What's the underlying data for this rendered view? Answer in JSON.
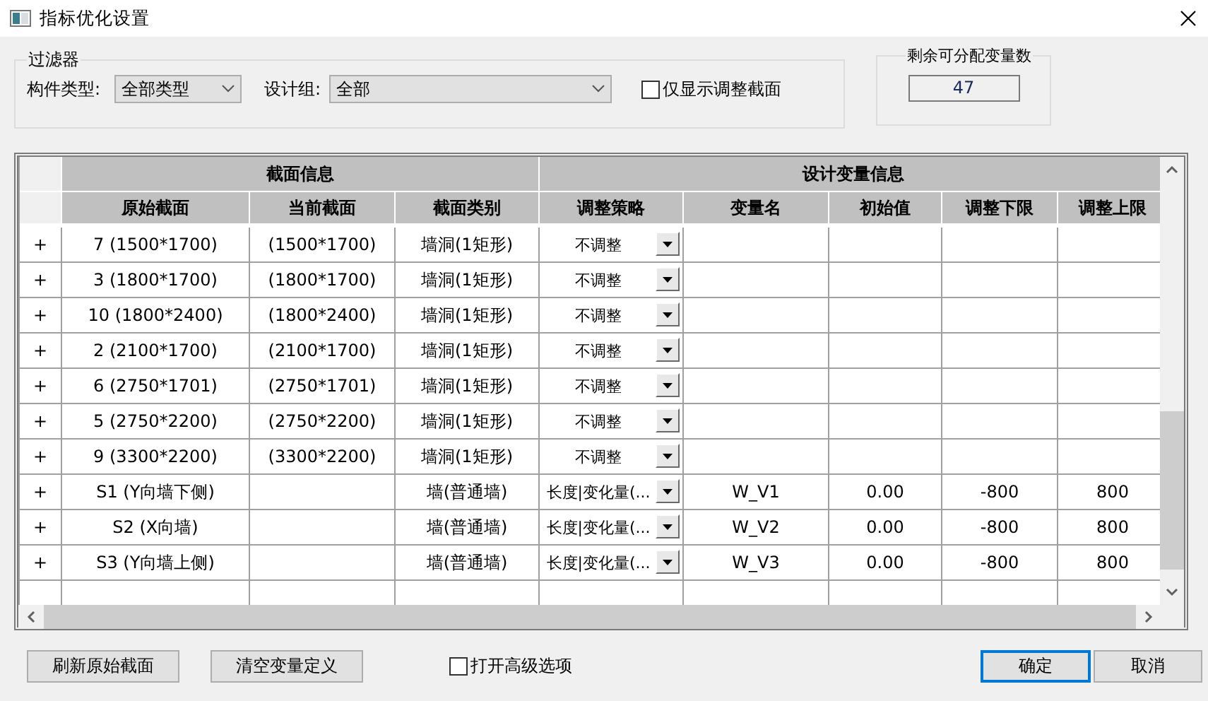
{
  "window": {
    "title": "指标优化设置"
  },
  "filter": {
    "legend": "过滤器",
    "component_type": {
      "label": "构件类型:",
      "value": "全部类型"
    },
    "design_group": {
      "label": "设计组:",
      "value": "全部"
    },
    "only_adjusted": {
      "label": "仅显示调整截面",
      "checked": false
    }
  },
  "remaining": {
    "legend": "剩余可分配变量数",
    "value": "47"
  },
  "table": {
    "groups": [
      {
        "label": "截面信息",
        "columns": [
          {
            "label": "原始截面"
          },
          {
            "label": "当前截面"
          },
          {
            "label": "截面类别"
          }
        ]
      },
      {
        "label": "设计变量信息",
        "columns": [
          {
            "label": "调整策略",
            "kind": "dropdown"
          },
          {
            "label": "变量名"
          },
          {
            "label": "初始值"
          },
          {
            "label": "调整下限"
          },
          {
            "label": "调整上限"
          }
        ]
      }
    ],
    "rows": [
      {
        "kind": "opening",
        "expander": "+",
        "cells": [
          "7 (1500*1700)",
          "(1500*1700)",
          "墙洞(1矩形)",
          "不调整"
        ]
      },
      {
        "kind": "opening",
        "expander": "+",
        "cells": [
          "3 (1800*1700)",
          "(1800*1700)",
          "墙洞(1矩形)",
          "不调整"
        ]
      },
      {
        "kind": "opening",
        "expander": "+",
        "cells": [
          "10 (1800*2400)",
          "(1800*2400)",
          "墙洞(1矩形)",
          "不调整"
        ]
      },
      {
        "kind": "opening",
        "expander": "+",
        "cells": [
          "2 (2100*1700)",
          "(2100*1700)",
          "墙洞(1矩形)",
          "不调整"
        ]
      },
      {
        "kind": "opening",
        "expander": "+",
        "cells": [
          "6 (2750*1701)",
          "(2750*1701)",
          "墙洞(1矩形)",
          "不调整"
        ]
      },
      {
        "kind": "opening",
        "expander": "+",
        "cells": [
          "5 (2750*2200)",
          "(2750*2200)",
          "墙洞(1矩形)",
          "不调整"
        ]
      },
      {
        "kind": "opening",
        "expander": "+",
        "cells": [
          "9 (3300*2200)",
          "(3300*2200)",
          "墙洞(1矩形)",
          "不调整"
        ]
      },
      {
        "kind": "wall",
        "expander": "+",
        "cells": [
          "S1 (Y向墙下侧)",
          "墙(普通墙)",
          "长度|变化量(...",
          "W_V1",
          "0.00",
          "-800",
          "800"
        ]
      },
      {
        "kind": "wall",
        "expander": "+",
        "cells": [
          "S2 (X向墙)",
          "墙(普通墙)",
          "长度|变化量(...",
          "W_V2",
          "0.00",
          "-800",
          "800"
        ]
      },
      {
        "kind": "wall",
        "expander": "+",
        "cells": [
          "S3 (Y向墙上侧)",
          "墙(普通墙)",
          "长度|变化量(...",
          "W_V3",
          "0.00",
          "-800",
          "800"
        ]
      }
    ]
  },
  "footer": {
    "refresh": "刷新原始截面",
    "clear": "清空变量定义",
    "advanced": {
      "label": "打开高级选项",
      "checked": false
    },
    "buttons": [
      {
        "label": "确定",
        "default": true
      },
      {
        "label": "取消",
        "default": false
      }
    ]
  }
}
